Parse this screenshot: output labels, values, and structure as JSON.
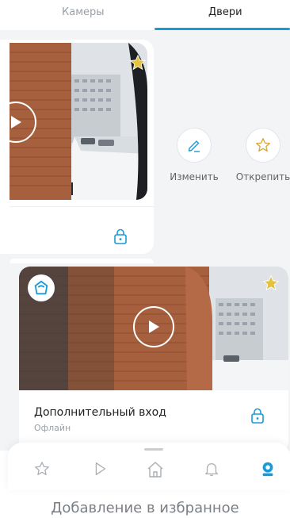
{
  "tabs": {
    "cameras": "Камеры",
    "doors": "Двери"
  },
  "swipe_actions": {
    "edit": "Изменить",
    "unpin": "Открепить"
  },
  "door_card": {
    "title": "Дополнительный вход",
    "status": "Офлайн"
  },
  "caption": "Добавление в избранное",
  "colors": {
    "accent": "#1a9bd7",
    "star": "#e5c23b",
    "icon_gold": "#d9a53c",
    "background": "#f3f4f6"
  },
  "icons": [
    "play-icon",
    "star-icon",
    "lock-icon",
    "edit-icon",
    "unpin-star-icon",
    "intercom-avatar-icon",
    "nav-favorites-icon",
    "nav-play-icon",
    "nav-home-icon",
    "nav-bell-icon",
    "nav-profile-icon"
  ]
}
